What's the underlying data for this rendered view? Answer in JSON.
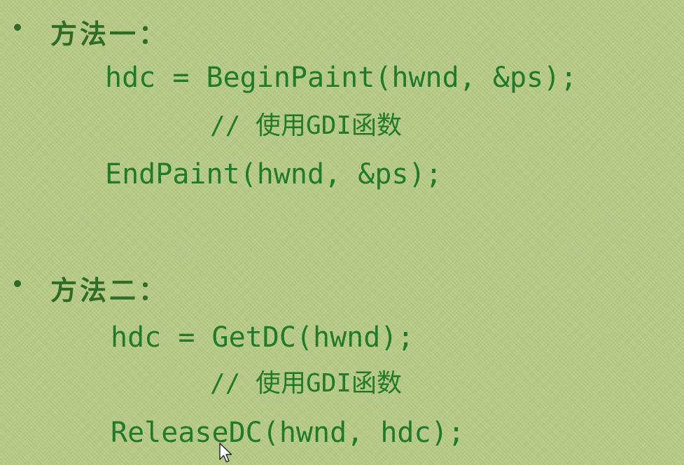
{
  "method1": {
    "heading": "方法一：",
    "line1": "hdc = BeginPaint(hwnd, &ps);",
    "comment": "// 使用GDI函数",
    "line2": "EndPaint(hwnd, &ps);"
  },
  "method2": {
    "heading": "方法二：",
    "line1": "hdc = GetDC(hwnd);",
    "comment": "// 使用GDI函数",
    "line2": "ReleaseDC(hwnd, hdc);"
  },
  "colors": {
    "background": "#b7cc85",
    "text": "#1f7a2a"
  },
  "icons": {
    "cursor": "mouse-pointer-icon"
  }
}
